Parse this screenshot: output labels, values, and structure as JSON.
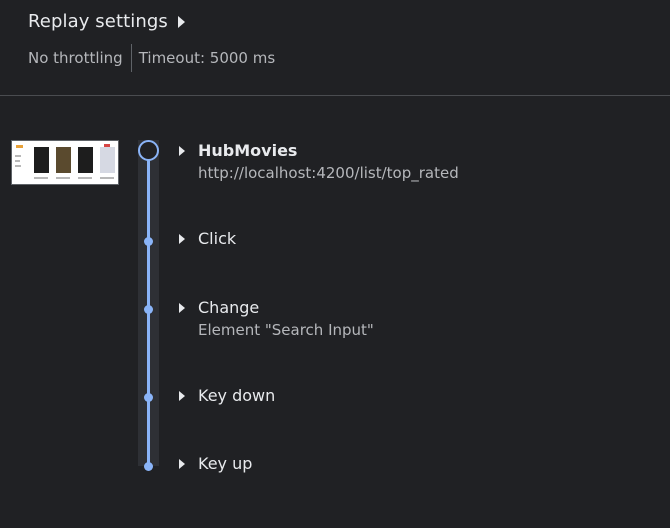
{
  "header": {
    "title": "Replay settings",
    "settings": {
      "throttling": "No throttling",
      "timeout": "Timeout: 5000 ms"
    }
  },
  "steps": [
    {
      "title": "HubMovies",
      "subtitle": "http://localhost:4200/list/top_rated"
    },
    {
      "title": "Click"
    },
    {
      "title": "Change",
      "subtitle": "Element \"Search Input\""
    },
    {
      "title": "Key down"
    },
    {
      "title": "Key up"
    }
  ],
  "colors": {
    "background": "#202124",
    "timeline_accent": "#8ab4f8",
    "divider": "#4a4c50"
  }
}
